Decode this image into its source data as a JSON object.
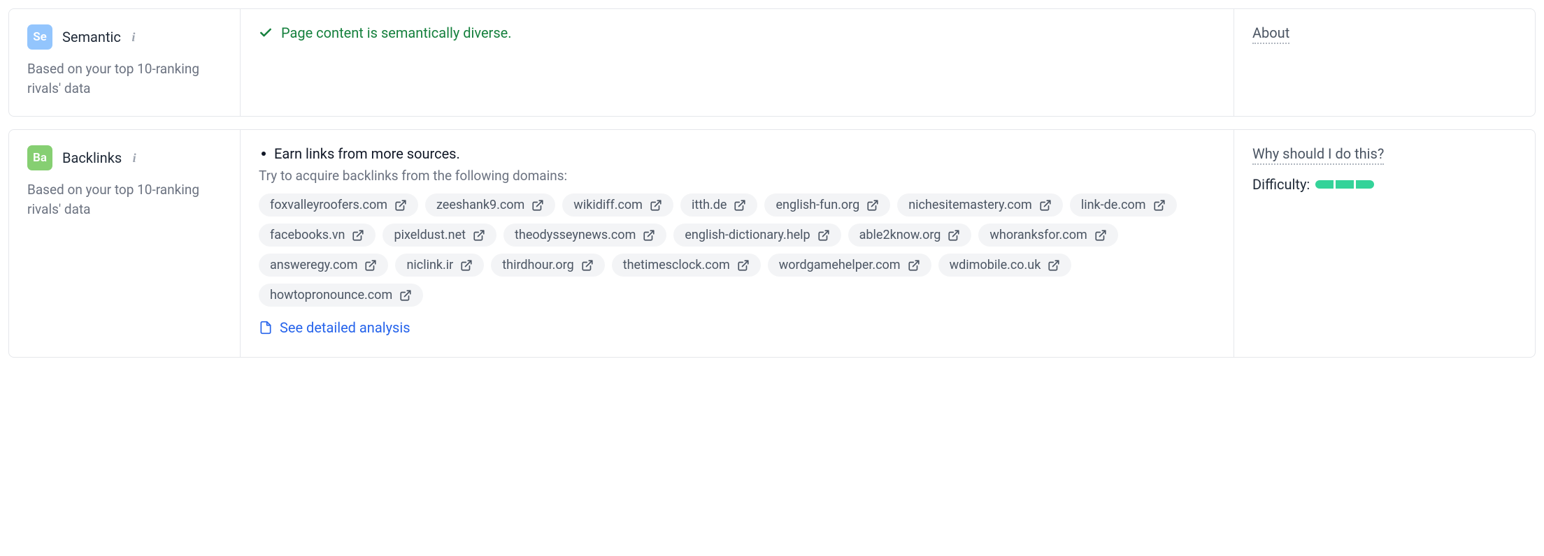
{
  "cards": {
    "semantic": {
      "badge": "Se",
      "title": "Semantic",
      "subtitle": "Based on your top 10-ranking rivals' data",
      "status": "Page content is semantically diverse.",
      "about": "About"
    },
    "backlinks": {
      "badge": "Ba",
      "title": "Backlinks",
      "subtitle": "Based on your top 10-ranking rivals' data",
      "bullet": "Earn links from more sources.",
      "hint": "Try to acquire backlinks from the following domains:",
      "domains": [
        "foxvalleyroofers.com",
        "zeeshank9.com",
        "wikidiff.com",
        "itth.de",
        "english-fun.org",
        "nichesitemastery.com",
        "link-de.com",
        "facebooks.vn",
        "pixeldust.net",
        "theodysseynews.com",
        "english-dictionary.help",
        "able2know.org",
        "whoranksfor.com",
        "answeregy.com",
        "niclink.ir",
        "thirdhour.org",
        "thetimesclock.com",
        "wordgamehelper.com",
        "wdimobile.co.uk",
        "howtopronounce.com"
      ],
      "detail_link": "See detailed analysis",
      "why": "Why should I do this?",
      "difficulty_label": "Difficulty:",
      "difficulty_segments": 3
    }
  }
}
